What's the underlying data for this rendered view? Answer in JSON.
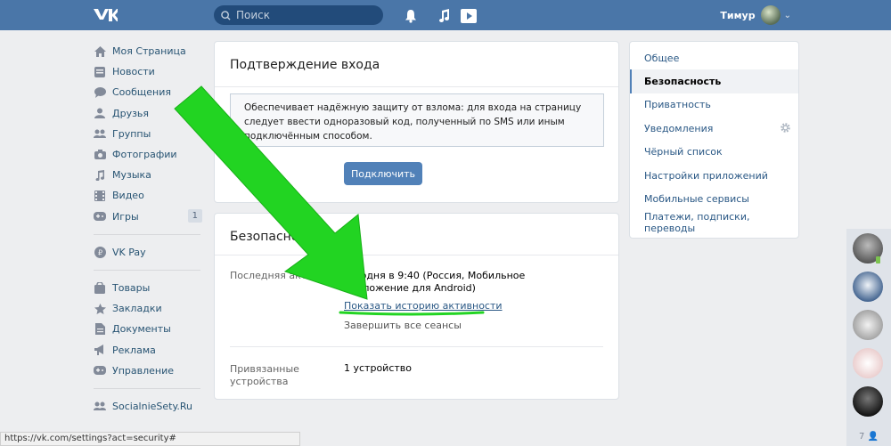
{
  "header": {
    "search_placeholder": "Поиск",
    "user_name": "Тимур"
  },
  "leftnav": {
    "items": [
      {
        "label": "Моя Страница",
        "icon": "home-icon"
      },
      {
        "label": "Новости",
        "icon": "news-icon"
      },
      {
        "label": "Сообщения",
        "icon": "messages-icon"
      },
      {
        "label": "Друзья",
        "icon": "friend-icon"
      },
      {
        "label": "Группы",
        "icon": "groups-icon"
      },
      {
        "label": "Фотографии",
        "icon": "camera-icon"
      },
      {
        "label": "Музыка",
        "icon": "music-icon"
      },
      {
        "label": "Видео",
        "icon": "video-icon"
      },
      {
        "label": "Игры",
        "icon": "gamepad-icon",
        "count": "1"
      }
    ],
    "vkpay": {
      "label": "VK Pay",
      "icon": "vkpay-icon"
    },
    "items2": [
      {
        "label": "Товары",
        "icon": "bag-icon"
      },
      {
        "label": "Закладки",
        "icon": "star-icon"
      },
      {
        "label": "Документы",
        "icon": "document-icon"
      },
      {
        "label": "Реклама",
        "icon": "megaphone-icon"
      },
      {
        "label": "Управление",
        "icon": "gamepad-icon"
      }
    ],
    "groups": [
      {
        "label": "SocialnieSety.Ru",
        "icon": "groups-icon"
      }
    ]
  },
  "login_confirm": {
    "title": "Подтверждение входа",
    "description": "Обеспечивает надёжную защиту от взлома: для входа на страницу следует ввести одноразовый код, полученный по SMS или иным подключённым способом.",
    "button": "Подключить"
  },
  "security": {
    "title": "Безопасность",
    "last_activity_label": "Последняя активность",
    "last_activity_value": "сегодня в 9:40 (Россия, Мобильное приложение для Android)",
    "show_history_link": "Показать историю активности",
    "end_sessions_link": "Завершить все сеансы",
    "devices_label": "Привязанные устройства",
    "devices_value": "1 устройство"
  },
  "settings_menu": {
    "items": [
      {
        "label": "Общее"
      },
      {
        "label": "Безопасность",
        "active": true
      },
      {
        "label": "Приватность"
      },
      {
        "label": "Уведомления"
      },
      {
        "label": "Чёрный список"
      },
      {
        "label": "Настройки приложений"
      },
      {
        "label": "Мобильные сервисы"
      },
      {
        "label": "Платежи, подписки, переводы"
      }
    ]
  },
  "chats_column": {
    "count": "7"
  },
  "statusbar": {
    "url": "https://vk.com/settings?act=security#"
  },
  "colors": {
    "header_bg": "#4a76a8",
    "accent": "#5181b8",
    "link": "#2a5885",
    "arrow": "#22d422"
  }
}
